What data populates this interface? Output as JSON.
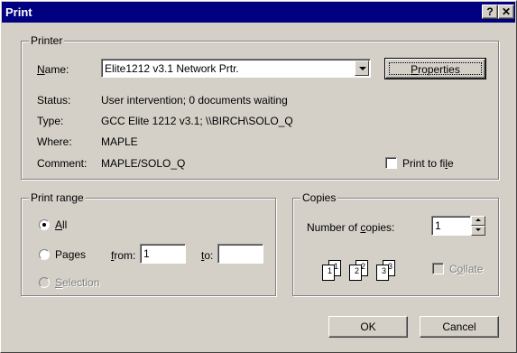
{
  "title": "Print",
  "titlebar": {
    "help_glyph": "?",
    "close_glyph": "✕"
  },
  "printer": {
    "legend": "Printer",
    "name_label": "Name:",
    "name_value": "Elite1212 v3.1 Network Prtr.",
    "properties_label": "Properties",
    "status_label": "Status:",
    "status_value": "User intervention; 0 documents waiting",
    "type_label": "Type:",
    "type_value": "GCC Elite 1212 v3.1; \\\\BIRCH\\SOLO_Q",
    "where_label": "Where:",
    "where_value": "MAPLE",
    "comment_label": "Comment:",
    "comment_value": "MAPLE/SOLO_Q",
    "print_to_file_label": "Print to file",
    "print_to_file_checked": false
  },
  "print_range": {
    "legend": "Print range",
    "all_label": "All",
    "pages_label": "Pages",
    "from_label": "from:",
    "from_value": "1",
    "to_label": "to:",
    "to_value": "",
    "selection_label": "Selection",
    "selected": "all"
  },
  "copies": {
    "legend": "Copies",
    "number_label": "Number of copies:",
    "number_value": "1",
    "collate_label": "Collate",
    "collate_checked": false,
    "collate_pages": [
      "1",
      "1",
      "2",
      "2",
      "3",
      "3"
    ]
  },
  "buttons": {
    "ok": "OK",
    "cancel": "Cancel"
  }
}
